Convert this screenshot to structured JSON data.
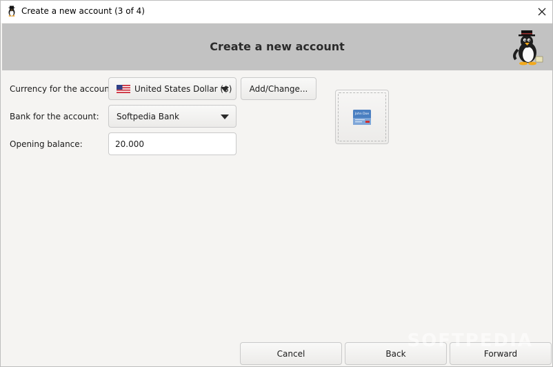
{
  "window": {
    "title": "Create a new account (3 of 4)"
  },
  "banner": {
    "title": "Create a new account"
  },
  "form": {
    "currency_label": "Currency for the account:",
    "currency_value": "United States Dollar ($)",
    "add_change_label": "Add/Change...",
    "bank_label": "Bank for the account:",
    "bank_value": "Softpedia Bank",
    "balance_label": "Opening balance:",
    "balance_value": "20.000"
  },
  "account_icon": {
    "card_name": "John Doe"
  },
  "footer": {
    "cancel_label": "Cancel",
    "back_label": "Back",
    "forward_label": "Forward"
  },
  "watermark": {
    "text": "SOFTPEDIA"
  },
  "colors": {
    "banner": "#c2c2c2",
    "background": "#f5f4f2",
    "card_blue": "#4a7fc1"
  }
}
